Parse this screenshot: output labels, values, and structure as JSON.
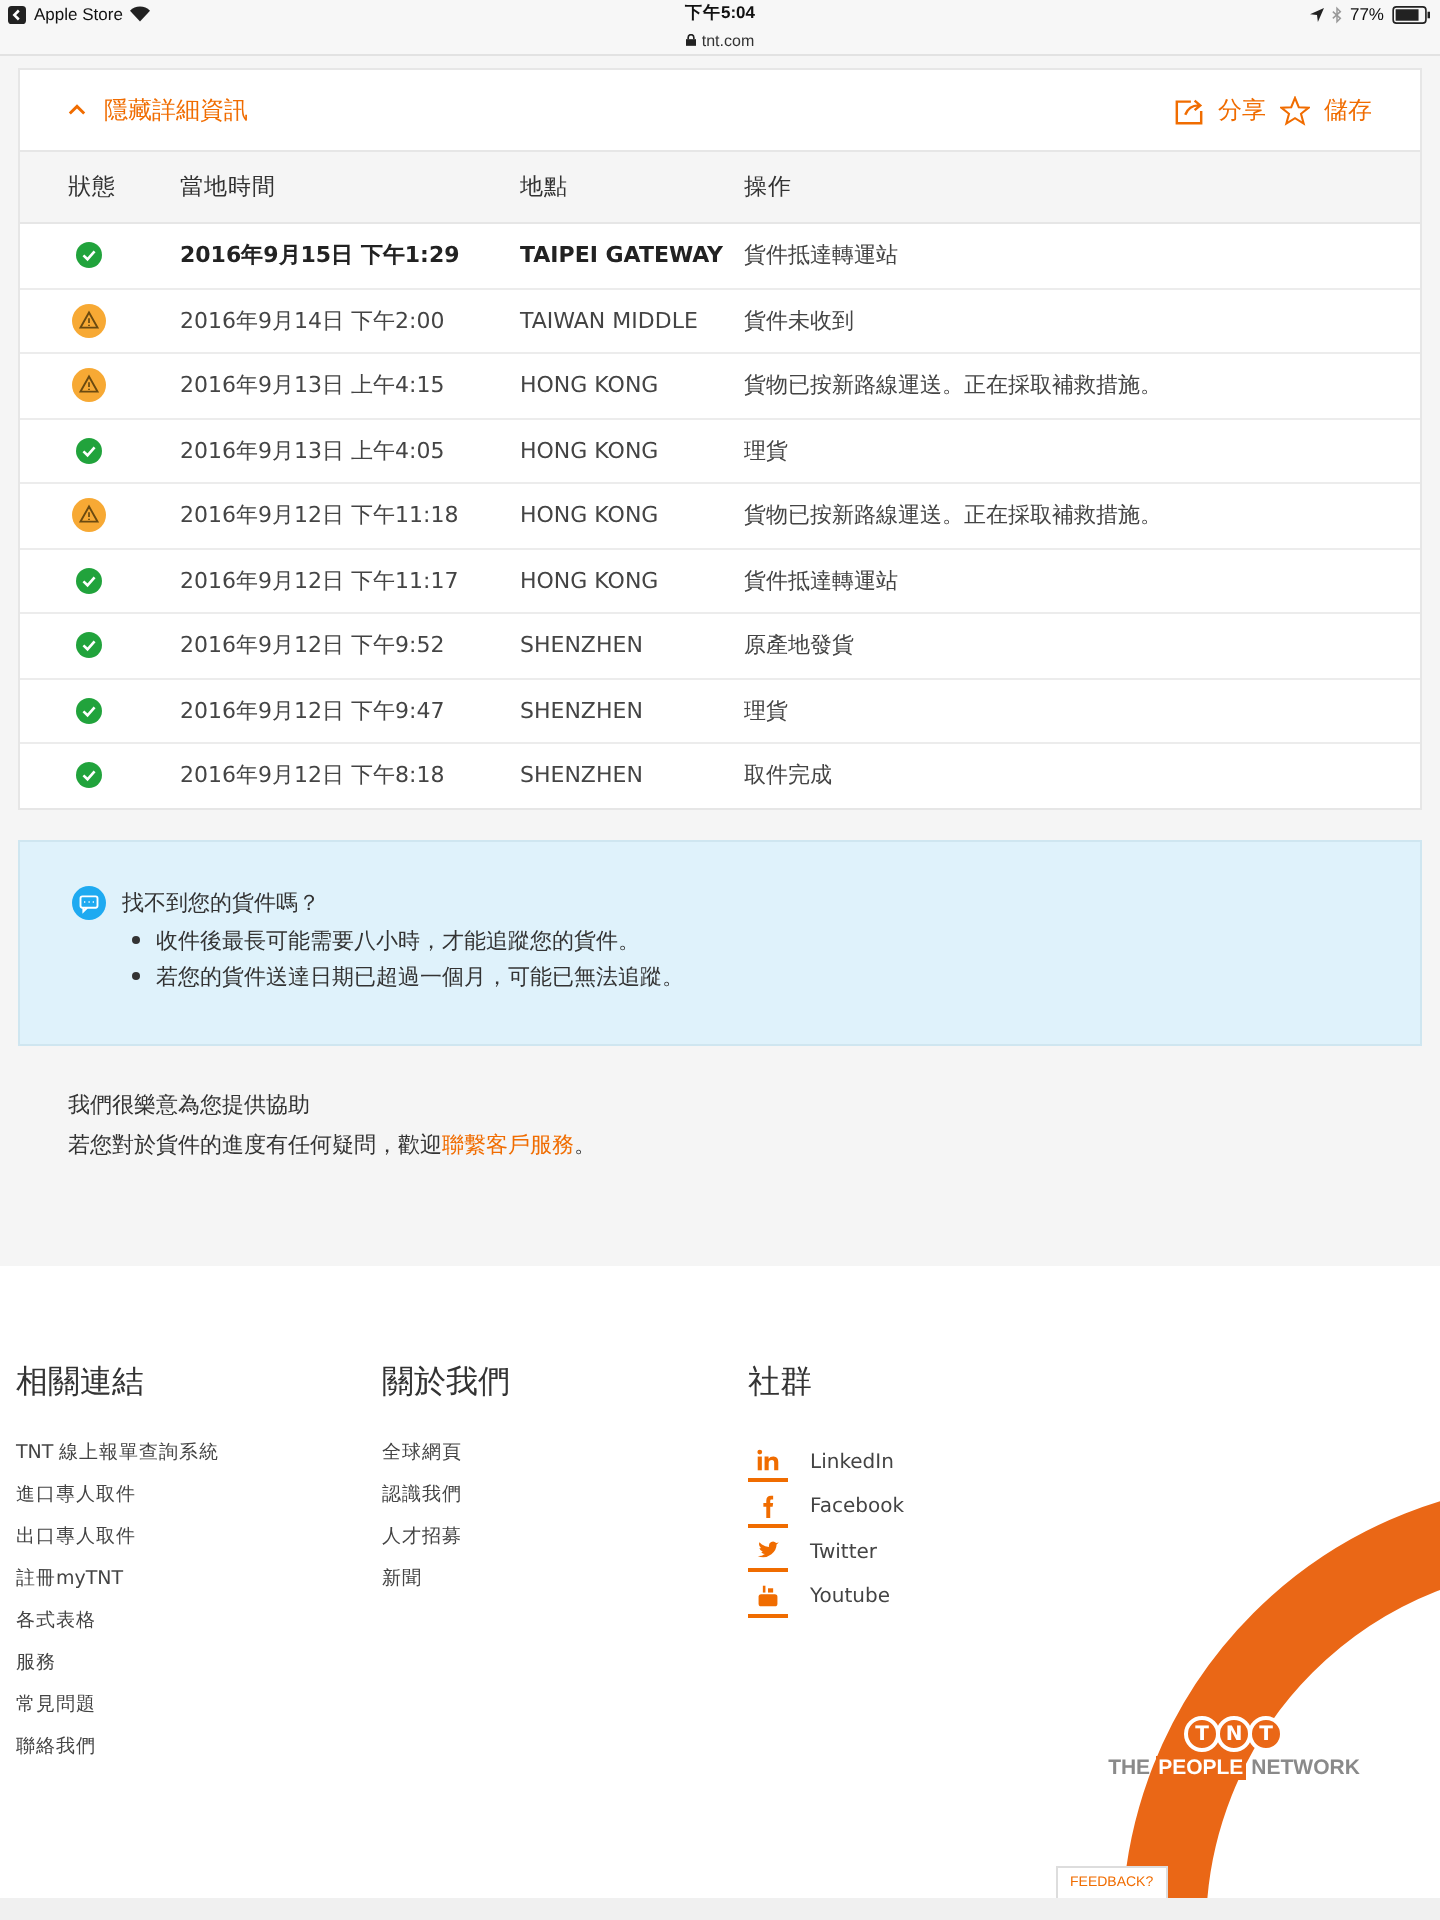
{
  "status_bar": {
    "back_app": "Apple Store",
    "time": "下午5:04",
    "url": "tnt.com",
    "battery": "77%"
  },
  "details": {
    "toggle": "隱藏詳細資訊",
    "expanded": true,
    "share": "分享",
    "save": "儲存"
  },
  "table": {
    "columns": [
      "狀態",
      "當地時間",
      "地點",
      "操作"
    ],
    "rows": [
      {
        "kind": "ok",
        "latest": true,
        "time": "2016年9月15日 下午1:29",
        "location": "TAIPEI GATEWAY",
        "action": "貨件抵達轉運站"
      },
      {
        "kind": "warning",
        "latest": false,
        "time": "2016年9月14日 下午2:00",
        "location": "TAIWAN MIDDLE",
        "action": "貨件未收到"
      },
      {
        "kind": "warning",
        "latest": false,
        "time": "2016年9月13日 上午4:15",
        "location": "HONG KONG",
        "action": "貨物已按新路線運送。正在採取補救措施。"
      },
      {
        "kind": "ok",
        "latest": false,
        "time": "2016年9月13日 上午4:05",
        "location": "HONG KONG",
        "action": "理貨"
      },
      {
        "kind": "warning",
        "latest": false,
        "time": "2016年9月12日 下午11:18",
        "location": "HONG KONG",
        "action": "貨物已按新路線運送。正在採取補救措施。"
      },
      {
        "kind": "ok",
        "latest": false,
        "time": "2016年9月12日 下午11:17",
        "location": "HONG KONG",
        "action": "貨件抵達轉運站"
      },
      {
        "kind": "ok",
        "latest": false,
        "time": "2016年9月12日 下午9:52",
        "location": "SHENZHEN",
        "action": "原產地發貨"
      },
      {
        "kind": "ok",
        "latest": false,
        "time": "2016年9月12日 下午9:47",
        "location": "SHENZHEN",
        "action": "理貨"
      },
      {
        "kind": "ok",
        "latest": false,
        "time": "2016年9月12日 下午8:18",
        "location": "SHENZHEN",
        "action": "取件完成"
      }
    ]
  },
  "notice": {
    "title": "找不到您的貨件嗎？",
    "items": [
      "收件後最長可能需要八小時，才能追蹤您的貨件。",
      "若您的貨件送達日期已超過一個月，可能已無法追蹤。"
    ]
  },
  "help": {
    "line1": "我們很樂意為您提供協助",
    "line2": "若您對於貨件的進度有任何疑問，歡迎",
    "link": "聯繫客戶服務",
    "end": "。"
  },
  "footer": {
    "columns": [
      {
        "title": "相關連結",
        "links": [
          "TNT 線上報單查詢系統",
          "進口專人取件",
          "出口專人取件",
          "註冊myTNT",
          "各式表格",
          "服務",
          "常見問題",
          "聯絡我們"
        ]
      },
      {
        "title": "關於我們",
        "links": [
          "全球網頁",
          "認識我們",
          "人才招募",
          "新聞"
        ]
      }
    ],
    "social": {
      "title": "社群",
      "links": [
        {
          "kind": "linkedin",
          "label": "LinkedIn"
        },
        {
          "kind": "facebook",
          "label": "Facebook"
        },
        {
          "kind": "twitter",
          "label": "Twitter"
        },
        {
          "kind": "youtube",
          "label": "Youtube"
        }
      ]
    },
    "logo": {
      "letters": [
        "T",
        "N",
        "T"
      ],
      "the": "THE",
      "people": "PEOPLE",
      "network": "NETWORK"
    },
    "feedback": "FEEDBACK?"
  }
}
